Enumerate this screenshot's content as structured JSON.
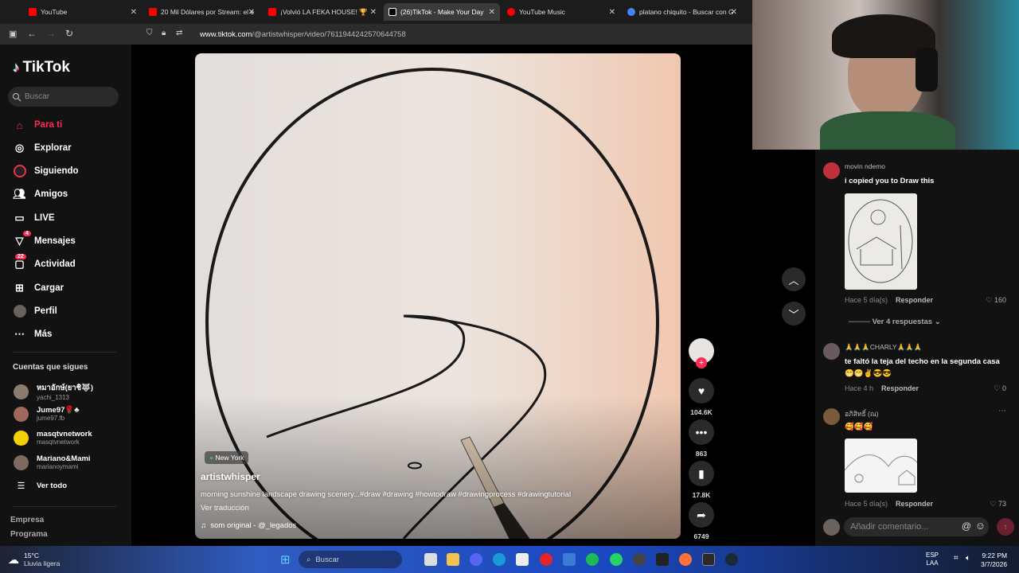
{
  "browser": {
    "tabs": [
      {
        "label": "YouTube",
        "color": "#ff0000"
      },
      {
        "label": "20 Mil Dólares por Stream: el e",
        "color": "#ff0000"
      },
      {
        "label": "¡Volvió LA FEKA HOUSE! 🏆",
        "color": "#ff0000"
      },
      {
        "label": "(26)TikTok - Make Your Day",
        "color": "#ffffff"
      },
      {
        "label": "YouTube Music",
        "color": "#ff0000"
      },
      {
        "label": "platano chiquito - Buscar con G",
        "color": "#4285f4"
      }
    ],
    "url_host": "www.tiktok.com",
    "url_path": "/@artistwhisper/video/7611944242570644758"
  },
  "sidebar": {
    "logo": "TikTok",
    "search_placeholder": "Buscar",
    "nav": [
      {
        "label": "Para ti",
        "icon": "home-icon",
        "active": true,
        "badge": ""
      },
      {
        "label": "Explorar",
        "icon": "compass-icon",
        "active": false,
        "badge": ""
      },
      {
        "label": "Siguiendo",
        "icon": "following-icon",
        "active": false,
        "badge": ""
      },
      {
        "label": "Amigos",
        "icon": "friends-icon",
        "active": false,
        "badge": ""
      },
      {
        "label": "LIVE",
        "icon": "live-icon",
        "active": false,
        "badge": ""
      },
      {
        "label": "Mensajes",
        "icon": "messages-icon",
        "active": false,
        "badge": "4"
      },
      {
        "label": "Actividad",
        "icon": "activity-icon",
        "active": false,
        "badge": "22"
      },
      {
        "label": "Cargar",
        "icon": "upload-icon",
        "active": false,
        "badge": ""
      },
      {
        "label": "Perfil",
        "icon": "profile-icon",
        "active": false,
        "badge": ""
      },
      {
        "label": "Más",
        "icon": "more-icon",
        "active": false,
        "badge": ""
      }
    ],
    "following_title": "Cuentas que sigues",
    "following": [
      {
        "name": "หมาอักษ์(ยาชิ🐺)",
        "handle": "yachi_1313",
        "color": "#8a7d70"
      },
      {
        "name": "Jume97🌹♣",
        "handle": "jume97.fb",
        "color": "#a0685a"
      },
      {
        "name": "masqtvnetwork",
        "handle": "masqtvnetwork",
        "color": "#f5d000"
      },
      {
        "name": "Mariano&Mami",
        "handle": "marianoymami",
        "color": "#7d6b60"
      }
    ],
    "see_all": "Ver todo",
    "footer": [
      "Empresa",
      "Programa"
    ]
  },
  "video": {
    "location": "New York",
    "author": "artistwhisper",
    "description": "morning sunshine landscape drawing scenery...#draw #drawing #howtodraw #drawingprocess #drawingtutorial",
    "translate": "Ver traducción",
    "sound": "som original - @_legados"
  },
  "actions": {
    "likes": "104.6K",
    "comments": "863",
    "saves": "17.8K",
    "shares": "6749"
  },
  "comments": [
    {
      "user": "movin ndemo",
      "text": "i copied you to Draw this",
      "time": "Hace 5 día(s)",
      "reply": "Responder",
      "likes": "160",
      "avatar": "#c0303a"
    },
    {
      "user": "🙏🙏🙏CHARLY🙏🙏🙏",
      "text": "te faltó la teja del techo en la segunda casa 😁😁✌😎😎",
      "time": "Hace 4 h",
      "reply": "Responder",
      "likes": "0",
      "avatar": "#6a5a60"
    },
    {
      "user": "อภิสิทธิ์ (ณ)",
      "text": "🥰🥰🥰",
      "time": "Hace 5 día(s)",
      "reply": "Responder",
      "likes": "73",
      "avatar": "#7a5a3a"
    }
  ],
  "replies_toggle": "Ver 4 respuestas",
  "comment_placeholder": "Añadir comentario...",
  "taskbar": {
    "temp": "15°C",
    "weather": "Lluvia ligera",
    "search": "Buscar",
    "lang": "ESP",
    "region": "LAA",
    "time": "9:22 PM",
    "date": "3/7/2026"
  }
}
